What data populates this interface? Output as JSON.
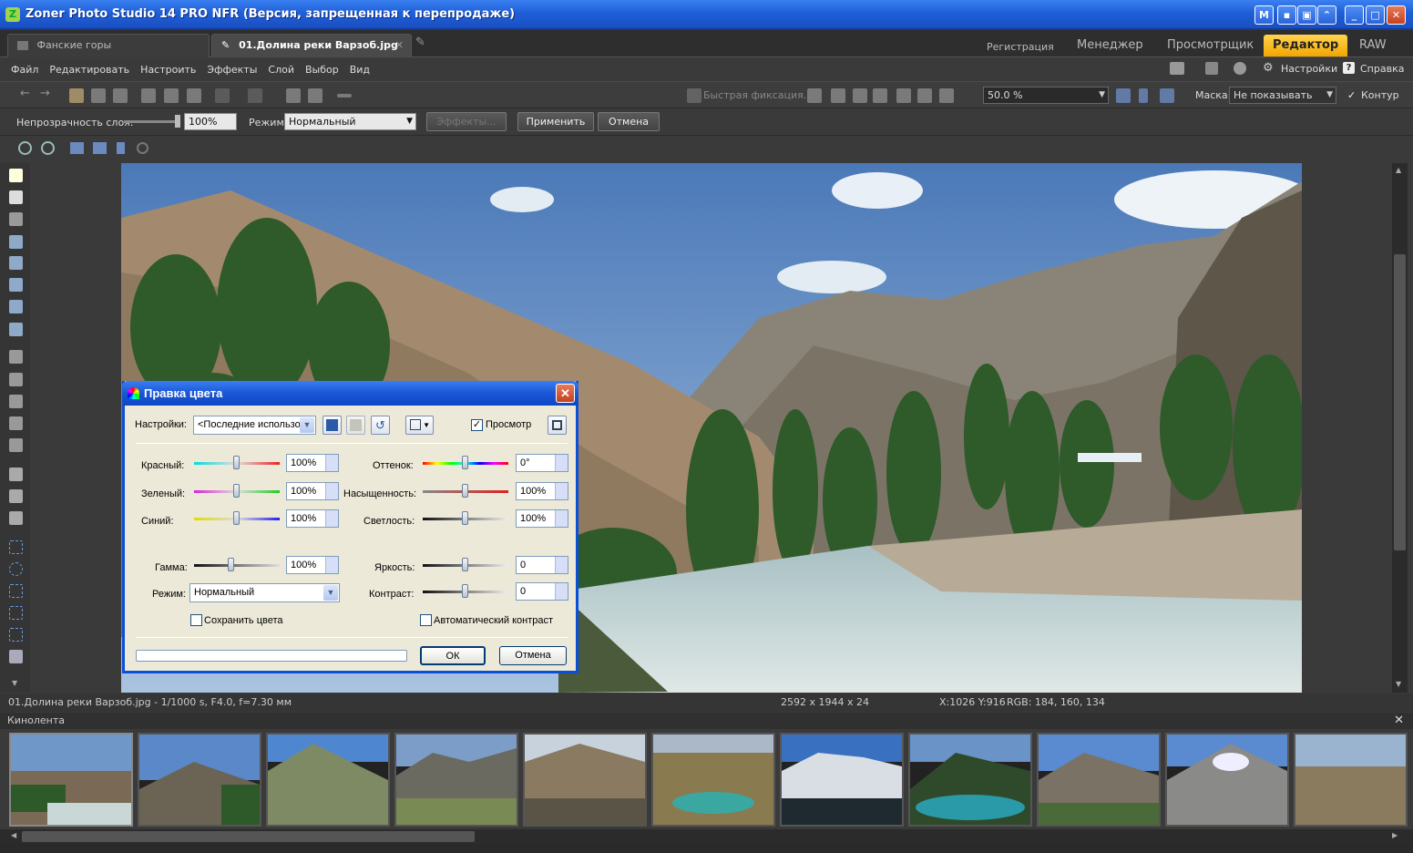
{
  "window": {
    "title": "Zoner Photo Studio 14 PRO NFR (Версия, запрещенная к перепродаже)"
  },
  "tabs": {
    "doc_tabs": [
      "Фанские горы",
      "01.Долина реки Варзоб.jpg"
    ],
    "register": "Регистрация",
    "modes": [
      "Менеджер",
      "Просмотрщик",
      "Редактор",
      "RAW"
    ],
    "active_mode": "Редактор"
  },
  "menu": {
    "items": [
      "Файл",
      "Редактировать",
      "Настроить",
      "Эффекты",
      "Слой",
      "Выбор",
      "Вид"
    ],
    "settings": "Настройки",
    "help": "Справка"
  },
  "toolbar": {
    "quick_fix": "Быстрая фиксация...",
    "zoom": "50.0 %",
    "mask_label": "Маска:",
    "mask_value": "Не показывать",
    "contour": "Контур"
  },
  "optbar": {
    "opacity_label": "Непрозрачность слоя:",
    "opacity_value": "100%",
    "mode_label": "Режим:",
    "mode_value": "Нормальный",
    "effects": "Эффекты...",
    "apply": "Применить",
    "cancel": "Отмена"
  },
  "status": {
    "file_info": "01.Долина реки Варзоб.jpg - 1/1000 s, F4.0, f=7.30 мм",
    "dimensions": "2592 x 1944 x 24",
    "coords": "X:1026 Y:916",
    "rgb": "RGB: 184, 160, 134"
  },
  "filmstrip": {
    "title": "Кинолента"
  },
  "dialog": {
    "title": "Правка цвета",
    "settings_label": "Настройки:",
    "settings_value": "<Последние использо",
    "preview": "Просмотр",
    "left": [
      {
        "label": "Красный:",
        "value": "100%"
      },
      {
        "label": "Зеленый:",
        "value": "100%"
      },
      {
        "label": "Синий:",
        "value": "100%"
      },
      {
        "label": "Гамма:",
        "value": "100%"
      }
    ],
    "right": [
      {
        "label": "Оттенок:",
        "value": "0°"
      },
      {
        "label": "Насыщенность:",
        "value": "100%"
      },
      {
        "label": "Светлость:",
        "value": "100%"
      },
      {
        "label": "Яркость:",
        "value": "0"
      },
      {
        "label": "Контраст:",
        "value": "0"
      }
    ],
    "mode_label": "Режим:",
    "mode_value": "Нормальный",
    "keep_colors": "Сохранить цвета",
    "auto_contrast": "Автоматический контраст",
    "ok": "ОК",
    "cancel": "Отмена"
  },
  "colors": {
    "accent": "#f2a500",
    "xp_blue": "#1a56d6",
    "dialog_bg": "#ece9d8"
  }
}
